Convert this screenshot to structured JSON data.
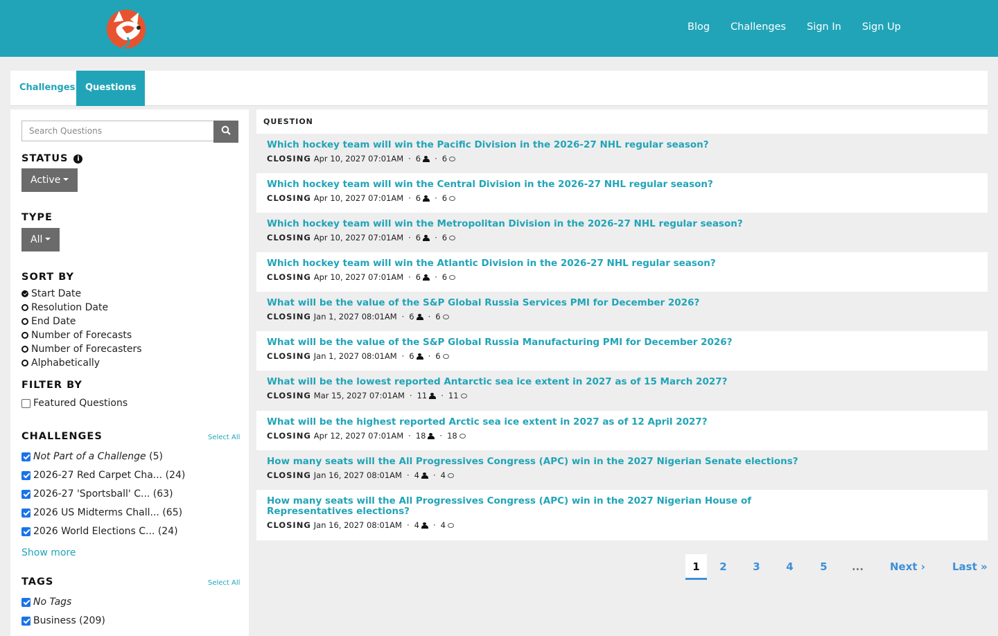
{
  "header": {
    "nav": [
      "Blog",
      "Challenges",
      "Sign In",
      "Sign Up"
    ],
    "brand_color": "#21a4b8"
  },
  "tabs": [
    {
      "label": "Challenges",
      "active": false
    },
    {
      "label": "Questions",
      "active": true
    }
  ],
  "sidebar": {
    "search_placeholder": "Search Questions",
    "status_title": "STATUS",
    "status_value": "Active",
    "type_title": "TYPE",
    "type_value": "All",
    "sort_title": "SORT BY",
    "sort_options": [
      "Start Date",
      "Resolution Date",
      "End Date",
      "Number of Forecasts",
      "Number of Forecasters",
      "Alphabetically"
    ],
    "sort_selected": "Start Date",
    "filter_title": "FILTER BY",
    "featured_label": "Featured Questions",
    "featured_checked": false,
    "challenges_title": "CHALLENGES",
    "select_all": "Select All",
    "challenges": [
      {
        "label": "Not Part of a Challenge",
        "count": "(5)",
        "italic": true,
        "checked": true
      },
      {
        "label": "2026-27 Red Carpet Cha...",
        "count": "(24)",
        "italic": false,
        "checked": true
      },
      {
        "label": "2026-27 'Sportsball' C...",
        "count": "(63)",
        "italic": false,
        "checked": true
      },
      {
        "label": "2026 US Midterms Chall...",
        "count": "(65)",
        "italic": false,
        "checked": true
      },
      {
        "label": "2026 World Elections C...",
        "count": "(24)",
        "italic": false,
        "checked": true
      }
    ],
    "show_more": "Show more",
    "tags_title": "TAGS",
    "tags": [
      {
        "label": "No Tags",
        "italic": true,
        "checked": true
      },
      {
        "label": "Business (209)",
        "italic": false,
        "checked": true
      }
    ]
  },
  "questions": {
    "header": "QUESTION",
    "closing_label": "CLOSING",
    "rows": [
      {
        "title": "Which hockey team will win the Pacific Division in the 2026-27 NHL regular season?",
        "date": "Apr 10, 2027 07:01AM",
        "forecasters": "6",
        "comments": "6"
      },
      {
        "title": "Which hockey team will win the Central Division in the 2026-27 NHL regular season?",
        "date": "Apr 10, 2027 07:01AM",
        "forecasters": "6",
        "comments": "6"
      },
      {
        "title": "Which hockey team will win the Metropolitan Division in the 2026-27 NHL regular season?",
        "date": "Apr 10, 2027 07:01AM",
        "forecasters": "6",
        "comments": "6"
      },
      {
        "title": "Which hockey team will win the Atlantic Division in the 2026-27 NHL regular season?",
        "date": "Apr 10, 2027 07:01AM",
        "forecasters": "6",
        "comments": "6"
      },
      {
        "title": "What will be the value of the S&P Global Russia Services PMI for December 2026?",
        "date": "Jan 1, 2027 08:01AM",
        "forecasters": "6",
        "comments": "6"
      },
      {
        "title": "What will be the value of the S&P Global Russia Manufacturing PMI for December 2026?",
        "date": "Jan 1, 2027 08:01AM",
        "forecasters": "6",
        "comments": "6"
      },
      {
        "title": "What will be the lowest reported Antarctic sea ice extent in 2027 as of 15 March 2027?",
        "date": "Mar 15, 2027 07:01AM",
        "forecasters": "11",
        "comments": "11"
      },
      {
        "title": "What will be the highest reported Arctic sea ice extent in 2027 as of 12 April 2027?",
        "date": "Apr 12, 2027 07:01AM",
        "forecasters": "18",
        "comments": "18"
      },
      {
        "title": "How many seats will the All Progressives Congress (APC) win in the 2027 Nigerian Senate elections?",
        "date": "Jan 16, 2027 08:01AM",
        "forecasters": "4",
        "comments": "4"
      },
      {
        "title": "How many seats will the All Progressives Congress (APC) win in the 2027 Nigerian House of Representatives elections?",
        "date": "Jan 16, 2027 08:01AM",
        "forecasters": "4",
        "comments": "4"
      }
    ]
  },
  "pagination": {
    "pages": [
      "1",
      "2",
      "3",
      "4",
      "5"
    ],
    "current": "1",
    "ellipsis": "...",
    "next": "Next ›",
    "last": "Last »"
  }
}
